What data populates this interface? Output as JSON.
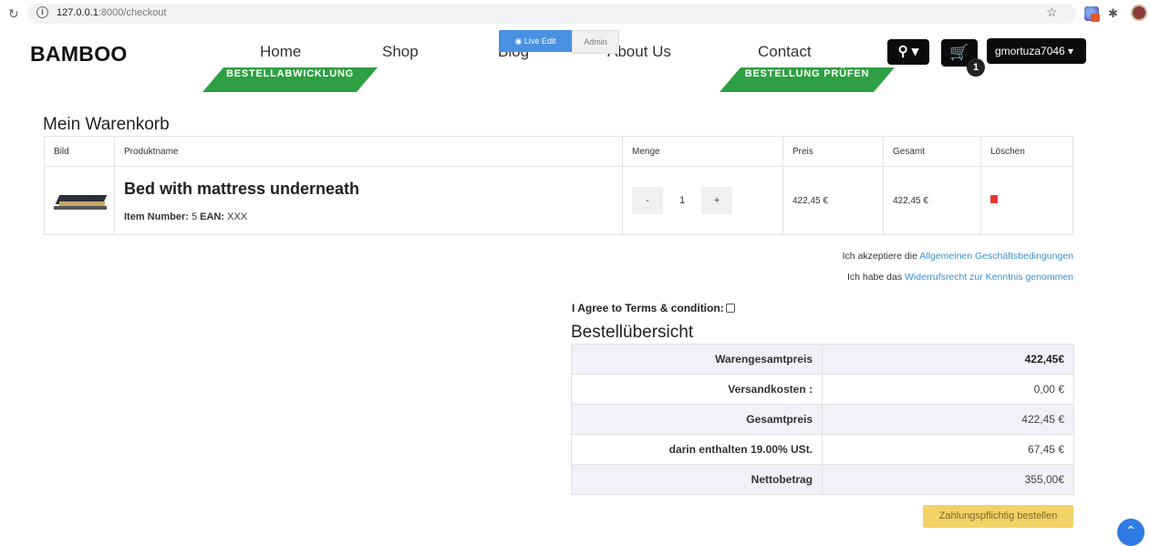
{
  "browser": {
    "url_host": "127.0.0.1",
    "url_path": ":8000/checkout"
  },
  "nav": {
    "brand": "BAMBOO",
    "home": "Home",
    "shop": "Shop",
    "blog": "Blog",
    "about": "About Us",
    "contact": "Contact",
    "live_edit": "Live Edit",
    "admin": "Admin",
    "cart_count": "1",
    "user": "gmortuza7046"
  },
  "steps": {
    "step1": "BESTELLABWICKLUNG",
    "step2": "BESTELLUNG PRÜFEN"
  },
  "cart": {
    "title": "Mein Warenkorb",
    "headers": [
      "Bild",
      "Produktname",
      "Menge",
      "Preis",
      "Gesamt",
      "Löschen"
    ],
    "item": {
      "name": "Bed with mattress underneath",
      "item_number_label": "Item Number:",
      "item_number": "5",
      "ean_label": "EAN:",
      "ean": "XXX",
      "qty_minus": "-",
      "qty": "1",
      "qty_plus": "+",
      "price": "422,45 €",
      "total": "422,45 €"
    }
  },
  "terms": {
    "line1_prefix": "Ich akzeptiere die",
    "line1_link": "Allgemeinen Geschäftsbedingungen",
    "line2_prefix": "Ich habe das",
    "line2_link": "Widerrufsrecht zur Kenntnis genommen",
    "agree": "I Agree to Terms & condition:"
  },
  "summary": {
    "title": "Bestellübersicht",
    "rows": [
      {
        "label": "Warengesamtpreis",
        "value": "422,45€"
      },
      {
        "label": "Versandkosten :",
        "value": "0,00 €"
      },
      {
        "label": "Gesamtpreis",
        "value": "422,45 €"
      },
      {
        "label": "darin enthalten 19.00% USt.",
        "value": "67,45 €"
      },
      {
        "label": "Nettobetrag",
        "value": "355,00€"
      }
    ],
    "order_button": "Zahlungspflichtig bestellen"
  }
}
